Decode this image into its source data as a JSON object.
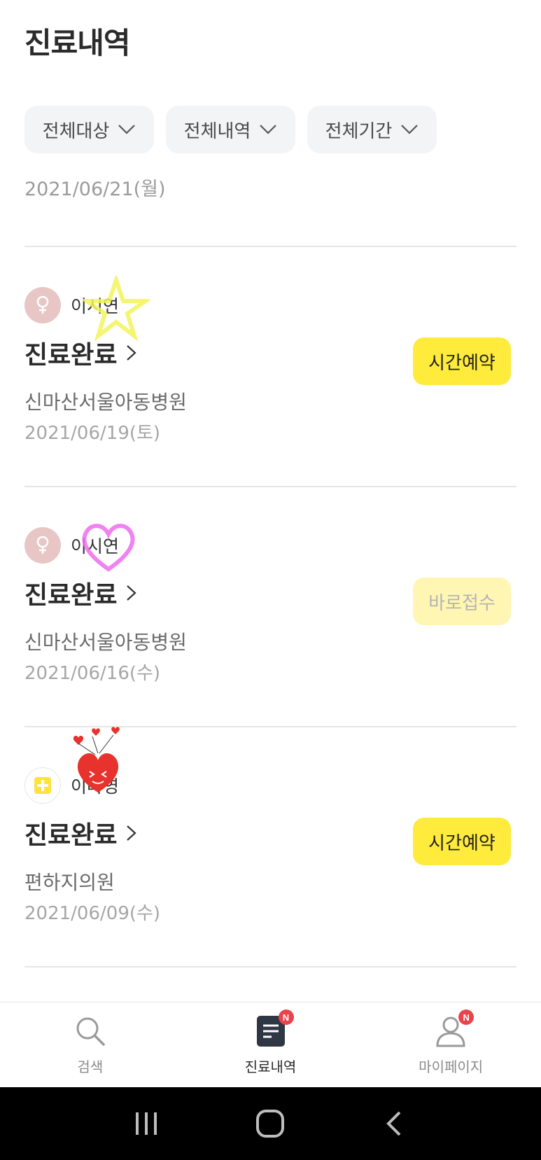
{
  "page": {
    "title": "진료내역"
  },
  "filters": [
    {
      "label": "전체대상"
    },
    {
      "label": "전체내역"
    },
    {
      "label": "전체기간"
    }
  ],
  "top_date": "2021/06/21(월)",
  "records": [
    {
      "patient": "이시연",
      "status": "진료완료",
      "hospital": "신마산서울아동병원",
      "date": "2021/06/19(토)",
      "action": "시간예약",
      "action_enabled": true,
      "avatar": "female-icon"
    },
    {
      "patient": "이시연",
      "status": "진료완료",
      "hospital": "신마산서울아동병원",
      "date": "2021/06/16(수)",
      "action": "바로접수",
      "action_enabled": false,
      "avatar": "female-icon"
    },
    {
      "patient": "이나영",
      "status": "진료완료",
      "hospital": "편하지의원",
      "date": "2021/06/09(수)",
      "action": "시간예약",
      "action_enabled": true,
      "avatar": "hospital-cross-icon"
    }
  ],
  "bottom_nav": {
    "search": {
      "label": "검색",
      "icon": "search-icon"
    },
    "history": {
      "label": "진료내역",
      "icon": "document-icon",
      "badge": "N"
    },
    "mypage": {
      "label": "마이페이지",
      "icon": "person-icon",
      "badge": "N"
    }
  },
  "colors": {
    "accent": "#ffeb3b",
    "badge": "#e9434c",
    "text": "#2b2b2b"
  }
}
